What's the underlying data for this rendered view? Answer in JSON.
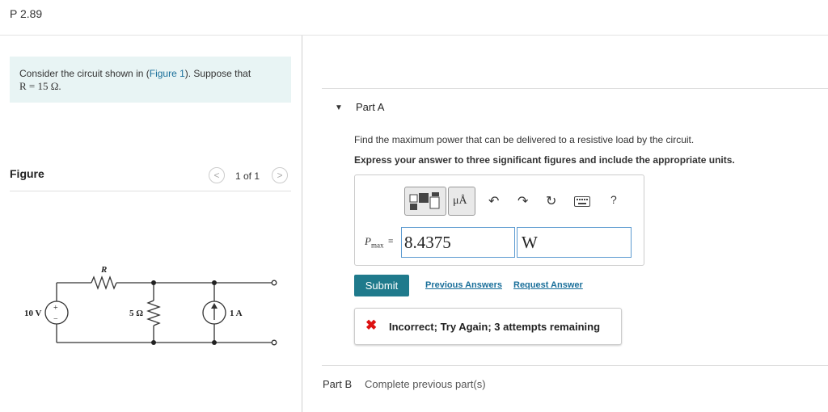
{
  "problem": {
    "title": "P 2.89"
  },
  "intro": {
    "prefix": "Consider the circuit shown in (",
    "figure_link": "Figure 1",
    "suffix": "). Suppose that",
    "resistance_eq": "R = 15 Ω."
  },
  "figure": {
    "label": "Figure",
    "counter": "1 of 1",
    "prev_glyph": "<",
    "next_glyph": ">",
    "circuit": {
      "resistor_label": "R",
      "source_voltage": "10 V",
      "source_plus": "+",
      "source_minus": "−",
      "shunt_resistor": "5 Ω",
      "current_source": "1 A"
    }
  },
  "partA": {
    "title": "Part A",
    "question": "Find the maximum power that can be delivered to a resistive load by the circuit.",
    "instruction": "Express your answer to three significant figures and include the appropriate units.",
    "toolbar": {
      "units_label": "μÅ",
      "help_label": "?"
    },
    "variable": "P",
    "variable_sub": "max",
    "equals": "=",
    "value": "8.4375",
    "unit": "W",
    "submit_label": "Submit",
    "previous_answers_label": "Previous Answers",
    "request_answer_label": "Request Answer",
    "feedback": {
      "icon": "✖",
      "message": "Incorrect; Try Again; 3 attempts remaining"
    }
  },
  "partB": {
    "title": "Part B",
    "status": "Complete previous part(s)"
  },
  "colors": {
    "submit": "#1f7a8c",
    "link": "#1a6f9a",
    "intro_bg": "#e8f4f4",
    "error": "#dd1111"
  }
}
